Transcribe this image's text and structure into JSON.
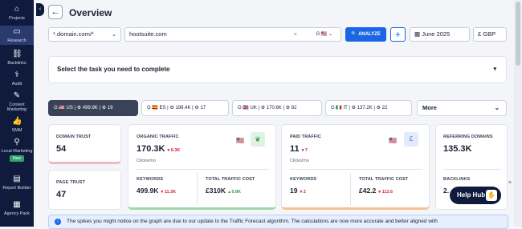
{
  "sidebar": {
    "items": [
      {
        "label": "Projects",
        "icon": "home-icon"
      },
      {
        "label": "Research",
        "icon": "monitor-icon"
      },
      {
        "label": "Backlinks",
        "icon": "link-icon"
      },
      {
        "label": "Audit",
        "icon": "pulse-icon"
      },
      {
        "label": "Content Marketing",
        "icon": "pencil-icon"
      },
      {
        "label": "SMM",
        "icon": "thumb-icon"
      },
      {
        "label": "Local Marketing",
        "icon": "pin-icon"
      },
      {
        "label": "Report Builder",
        "icon": "report-icon"
      },
      {
        "label": "Agency Pack",
        "icon": "building-icon"
      }
    ],
    "new_badge": "New"
  },
  "header": {
    "title": "Overview"
  },
  "search": {
    "scope": "*.domain.com/*",
    "domain": "hootsuite.com",
    "date": "June 2025",
    "currency": "£ GBP",
    "analyze_label": "ANALYZE"
  },
  "task": {
    "label": "Select the task you need to complete"
  },
  "db_tabs": [
    {
      "country": "US",
      "a": "499.9K",
      "b": "19"
    },
    {
      "country": "ES",
      "a": "198.4K",
      "b": "17"
    },
    {
      "country": "UK",
      "a": "170.6K",
      "b": "82"
    },
    {
      "country": "IT",
      "a": "137.2K",
      "b": "22"
    }
  ],
  "more_label": "More",
  "domain_trust": {
    "label": "DOMAIN TRUST",
    "value": "54"
  },
  "page_trust": {
    "label": "PAGE TRUST",
    "value": "47"
  },
  "organic": {
    "label": "ORGANIC TRAFFIC",
    "value": "170.3K",
    "delta": "▾ 6.3K",
    "sub": "Clicks/mo",
    "kw_label": "KEYWORDS",
    "kw_value": "499.9K",
    "kw_delta": "▾ 11.3K",
    "cost_label": "TOTAL TRAFFIC COST",
    "cost_value": "£310K",
    "cost_delta": "▴ 9.8K"
  },
  "paid": {
    "label": "PAID TRAFFIC",
    "value": "11",
    "delta": "▾ 7",
    "sub": "Clicks/mo",
    "kw_label": "KEYWORDS",
    "kw_value": "19",
    "kw_delta": "▾ 2",
    "cost_label": "TOTAL TRAFFIC COST",
    "cost_value": "£42.2",
    "cost_delta": "▾ 113.6"
  },
  "referring": {
    "label": "REFERRING DOMAINS",
    "value": "135.3K",
    "backlinks_label": "BACKLINKS",
    "backlinks_value": "2."
  },
  "help_label": "Help Hub",
  "notice": "The spikes you might notice on the graph are due to our update to the Traffic Forecast algorithm. The calculations are now more accurate and better aligned with"
}
